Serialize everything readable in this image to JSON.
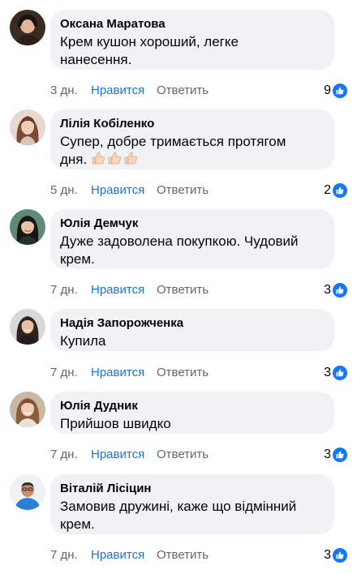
{
  "actions": {
    "like_label": "Нравится",
    "reply_label": "Ответить"
  },
  "colors": {
    "bubble": "#f0f2f5",
    "like_link": "#1b74e4",
    "muted": "#65676b",
    "like_badge": "#1877f2"
  },
  "comments": [
    {
      "author": "Оксана Маратова",
      "lines": [
        "Крем кушон хороший, легке",
        "нанесення."
      ],
      "time": "3 дн.",
      "likes": "9"
    },
    {
      "author": "Лілія Кобіленко",
      "lines": [
        "Супер, добре тримається протягом",
        "дня."
      ],
      "emoji": "thumbs-up-light-skin x3",
      "time": "5 дн.",
      "likes": "2"
    },
    {
      "author": "Юлія Демчук",
      "lines": [
        "Дуже задоволена покупкою. Чудовий",
        "крем."
      ],
      "time": "7 дн.",
      "likes": "3"
    },
    {
      "author": "Надія Запорожченка",
      "lines": [
        "Купила"
      ],
      "time": "7 дн.",
      "likes": "3"
    },
    {
      "author": "Юлія Дудник",
      "lines": [
        "Прийшов швидко"
      ],
      "time": "7 дн.",
      "likes": "3"
    },
    {
      "author": "Віталій Лісіцин",
      "lines": [
        "Замовив дружині, каже що відмінний",
        "крем."
      ],
      "time": "7 дн.",
      "likes": "3"
    }
  ]
}
